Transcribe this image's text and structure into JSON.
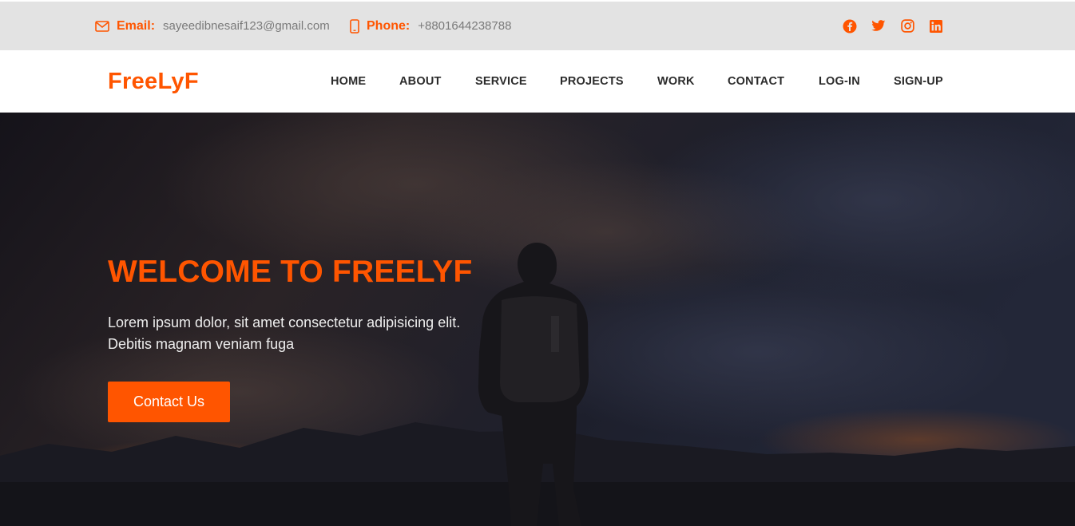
{
  "topbar": {
    "email_label": "Email:",
    "email_value": "sayeedibnesaif123@gmail.com",
    "email_icon": "envelope-icon",
    "phone_label": "Phone:",
    "phone_value": "+8801644238788",
    "phone_icon": "mobile-phone-icon",
    "socials": [
      "facebook-icon",
      "twitter-icon",
      "instagram-icon",
      "linkedin-icon"
    ]
  },
  "nav": {
    "brand": "FreeLyF",
    "items": [
      {
        "label": "HOME"
      },
      {
        "label": "ABOUT"
      },
      {
        "label": "SERVICE"
      },
      {
        "label": "PROJECTS"
      },
      {
        "label": "WORK"
      },
      {
        "label": "CONTACT"
      },
      {
        "label": "LOG-IN"
      },
      {
        "label": "SIGN-UP"
      }
    ]
  },
  "hero": {
    "title": "WELCOME TO FREELYF",
    "text_line1": "Lorem ipsum dolor, sit amet consectetur adipisicing elit.",
    "text_line2": "Debitis magnam veniam fuga",
    "button_label": "Contact Us"
  },
  "colors": {
    "accent": "#ff5500",
    "topbar_bg": "#e3e3e3",
    "nav_text": "#2b2b2b",
    "hero_bg": "#16141c"
  }
}
